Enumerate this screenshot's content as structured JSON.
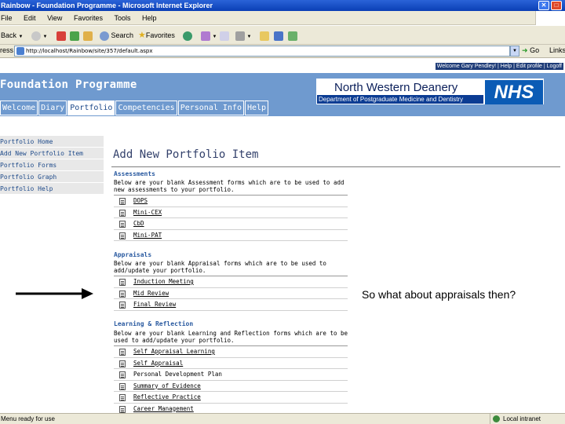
{
  "window": {
    "title": "Rainbow - Foundation Programme - Microsoft Internet Explorer"
  },
  "menubar": {
    "items": [
      "File",
      "Edit",
      "View",
      "Favorites",
      "Tools",
      "Help"
    ]
  },
  "toolbar": {
    "back": "Back",
    "search": "Search",
    "favorites": "Favorites"
  },
  "address": {
    "label": "ress",
    "url": "http://localhost/Rainbow/site/357/default.aspx",
    "go": "Go",
    "links": "Links"
  },
  "site": {
    "title": "Foundation Programme",
    "top_links": "Welcome Gary Pendley! | Help | Edit profile | Logoff",
    "banner_name": "North Western Deanery",
    "banner_dept": "Department of Postgraduate Medicine and Dentistry",
    "banner_logo": "NHS",
    "tabs": [
      "Welcome",
      "Diary",
      "Portfolio",
      "Competencies",
      "Personal Info",
      "Help"
    ],
    "active_tab": "Portfolio"
  },
  "sidemenu": {
    "items": [
      "Portfolio Home",
      "Add New Portfolio Item",
      "Portfolio Forms",
      "Portfolio Graph",
      "Portfolio Help"
    ]
  },
  "main": {
    "title": "Add New Portfolio Item",
    "sections": [
      {
        "heading": "Assessments",
        "description": "Below are your blank Assessment forms which are to be used to add new assessments to your portfolio.",
        "forms": [
          "DOPS",
          "Mini-CEX",
          "CbD",
          "Mini-PAT"
        ]
      },
      {
        "heading": "Appraisals",
        "description": "Below are your blank Appraisal forms which are to be used to add/update your portfolio.",
        "forms": [
          "Induction Meeting",
          "Mid Review",
          "Final Review"
        ]
      },
      {
        "heading": "Learning & Reflection",
        "description": "Below are your blank Learning and Reflection forms which are to be used to add/update your portfolio.",
        "forms": [
          "Self Appraisal Learning",
          "Self Appraisal",
          "Personal Development Plan",
          "Summary of Evidence",
          "Reflective Practice",
          "Career Management"
        ]
      }
    ]
  },
  "annotation": {
    "note": "So what about appraisals then?"
  },
  "statusbar": {
    "text": "Menu ready for use",
    "zone": "Local intranet"
  }
}
